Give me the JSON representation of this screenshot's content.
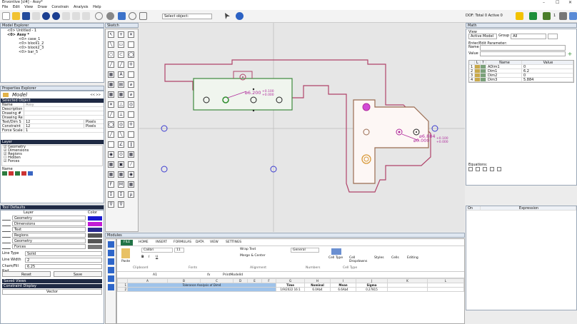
{
  "title": "Envontive [cl4] - Assy*",
  "window_controls": [
    "–",
    "☐",
    "✕"
  ],
  "menu": [
    "File",
    "Edit",
    "View",
    "Draw",
    "Constrain",
    "Analysis",
    "Help"
  ],
  "toolbar": {
    "select_label": "Select object:",
    "dof_text": "DOF: Total 0  Active 0",
    "readout": "1"
  },
  "model_explorer": {
    "title": "Model Explorer",
    "items": [
      "<0> Untitled - 1",
      "<0> Assy *",
      "<0> case_1",
      "<0> block1_2",
      "<0> block2_3",
      "<0> bar_5"
    ]
  },
  "properties": {
    "title": "Properties Explorer",
    "model_label": "Model",
    "nav": "<< >>",
    "section_selected": "Selected Object",
    "fields": [
      {
        "label": "Name",
        "value": "Assy"
      },
      {
        "label": "Description",
        "value": ""
      },
      {
        "label": "Drawing #",
        "value": ""
      },
      {
        "label": "Drawing Re",
        "value": ""
      },
      {
        "label": "Text/Dim S",
        "value": "12"
      },
      {
        "label": "Constraint",
        "value": "12"
      },
      {
        "label": "Force Scale",
        "value": "1"
      }
    ],
    "text_unit": "Pixels",
    "constraint_unit": "Pixels",
    "section_layer": "Layer",
    "layers": [
      "Geometry",
      "Dimensions",
      "Regions",
      "Hidden",
      "Forces"
    ],
    "name_label": "Name"
  },
  "tool_defaults": {
    "title": "Tool Defaults",
    "col_layer": "Layer",
    "col_color": "Color",
    "rows": [
      {
        "label": "Geometry",
        "color": "#1a1ad0"
      },
      {
        "label": "Dimensions",
        "color": "#c21cd6"
      },
      {
        "label": "Text",
        "color": "#2a2a8f"
      },
      {
        "label": "Regions",
        "color": "#555555"
      },
      {
        "label": "Geometry",
        "color": "#555555"
      },
      {
        "label": "Forces",
        "color": "#777777"
      }
    ],
    "line_type_label": "Line Type",
    "line_type": "Solid",
    "line_width_label": "Line Width",
    "line_width": "2",
    "chamfer_label": "Cham/Fill Rad",
    "chamfer": "6.25",
    "reset": "Reset",
    "save": "Save",
    "saved_views": "Saved Views",
    "constraint_display": "Constraint Display",
    "vector_label": "Vector"
  },
  "sketch": {
    "title": "Sketch"
  },
  "canvas": {
    "dim1_text": "⌀6.200",
    "dim1_tol_plus": "+0.100",
    "dim1_tol_minus": "+0.000",
    "dim2_text": "⌀6.884",
    "dim2_alt": "⌀0.000",
    "dim2_tol_plus": "+0.100",
    "dim2_tol_minus": "+0.000"
  },
  "modules": {
    "title": "Modules",
    "tabs": [
      "FILE",
      "HOME",
      "INSERT",
      "FORMULAS",
      "DATA",
      "VIEW",
      "SETTINGS"
    ],
    "font_name": "Calibri",
    "font_size": "11",
    "wrap_text": "Wrap Text",
    "merge_center": "Merge & Center",
    "number_format": "General",
    "cell_type": "Cell Type",
    "cell_dropdowns": "Cell Dropdowns",
    "styles": "Styles",
    "cells": "Cells",
    "editing": "Editing",
    "paste": "Paste",
    "groups": [
      "Clipboard",
      "Fonts",
      "Alignment",
      "Numbers",
      "Cell Type"
    ],
    "cell_ref": "A1",
    "fx": "fx",
    "formula": "PrintModelId",
    "columns": [
      "A",
      "B",
      "C",
      "D",
      "E",
      "F",
      "G",
      "H",
      "I",
      "J",
      "K",
      "L"
    ],
    "sheet_title": "Tolerance Analysis of Dim4",
    "headers": [
      "Time",
      "Nominal",
      "Mean",
      "Sigma"
    ],
    "row2": [
      "1/9/2022 16:1",
      "6.0Ab4",
      "6.6Ab4",
      "0.27815"
    ]
  },
  "math": {
    "title": "Math",
    "view_label": "View",
    "view_value": "Active Model",
    "group_label": "Group",
    "group_value": "All",
    "enter_edit": "Enter/Edit Parameter:",
    "name_label": "Name",
    "value_label": "Value",
    "col_l": "L",
    "col_q": "?",
    "col_name": "Name",
    "col_value": "Value",
    "rows": [
      {
        "n": "1",
        "name": "ADim1",
        "value": "0"
      },
      {
        "n": "2",
        "name": "Dim1",
        "value": "6.2"
      },
      {
        "n": "3",
        "name": "Dim2",
        "value": "0"
      },
      {
        "n": "4",
        "name": "Dim3",
        "value": "5.884"
      }
    ],
    "equations_label": "Equations:",
    "eq_col_on": "On",
    "eq_col_expr": "Expression"
  }
}
